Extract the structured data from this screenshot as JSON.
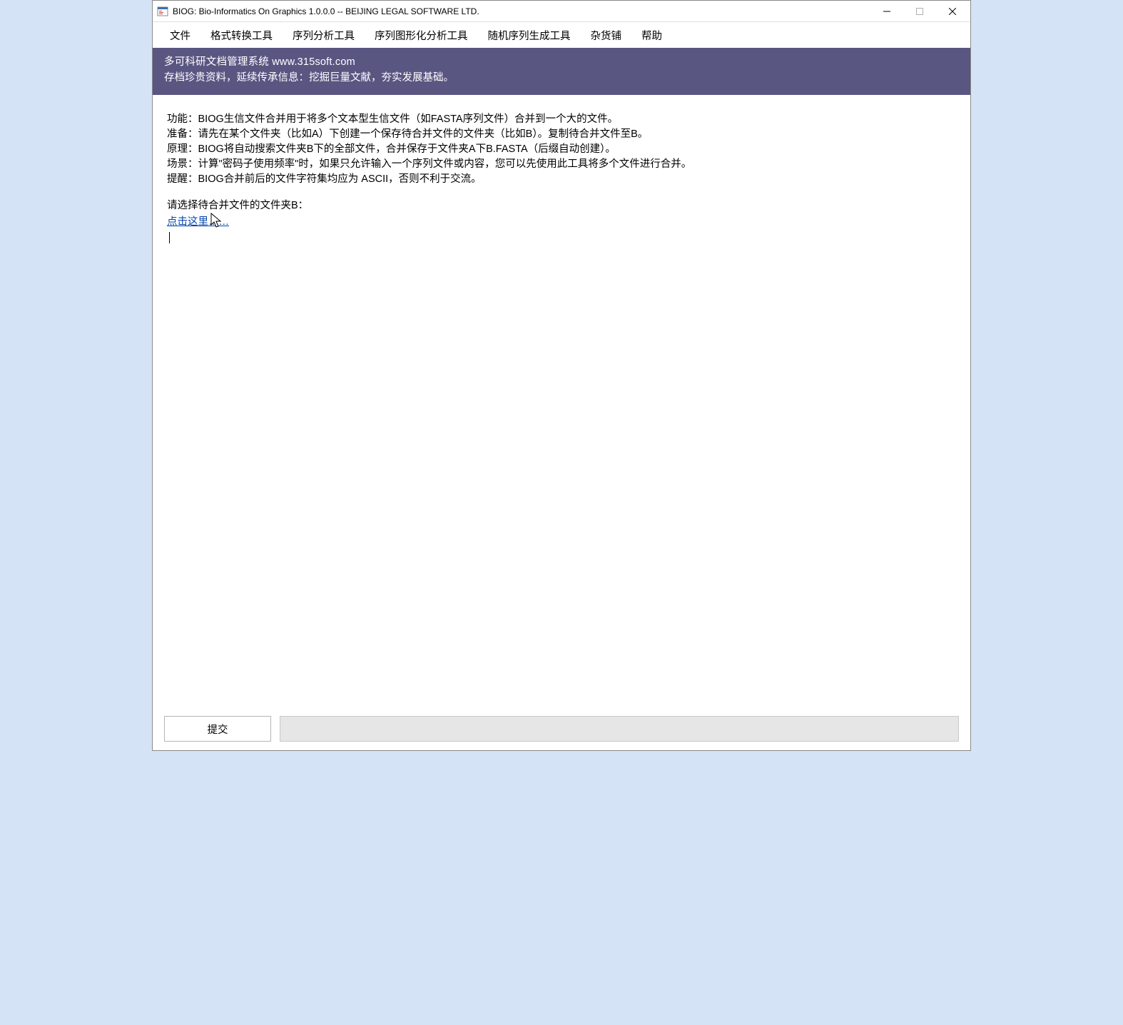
{
  "window": {
    "title": "BIOG: Bio-Informatics On Graphics 1.0.0.0 -- BEIJING LEGAL SOFTWARE LTD."
  },
  "menubar": {
    "items": [
      "文件",
      "格式转换工具",
      "序列分析工具",
      "序列图形化分析工具",
      "随机序列生成工具",
      "杂货铺",
      "帮助"
    ]
  },
  "banner": {
    "line1": "多可科研文档管理系统 www.315soft.com",
    "line2": "存档珍贵资料，延续传承信息：挖掘巨量文献，夯实发展基础。"
  },
  "description": {
    "line1": "功能：BIOG生信文件合并用于将多个文本型生信文件（如FASTA序列文件）合并到一个大的文件。",
    "line2": "准备：请先在某个文件夹（比如A）下创建一个保存待合并文件的文件夹（比如B）。复制待合并文件至B。",
    "line3": "原理：BIOG将自动搜索文件夹B下的全部文件，合并保存于文件夹A下B.FASTA（后缀自动创建）。",
    "line4": "场景：计算\"密码子使用频率\"时，如果只允许输入一个序列文件或内容，您可以先使用此工具将多个文件进行合并。",
    "line5": "提醒：BIOG合并前后的文件字符集均应为 ASCII，否则不利于交流。"
  },
  "prompt": "请选择待合并文件的文件夹B：",
  "link_label": "点击这里……",
  "submit_label": "提交",
  "textarea_value": "",
  "status_value": ""
}
